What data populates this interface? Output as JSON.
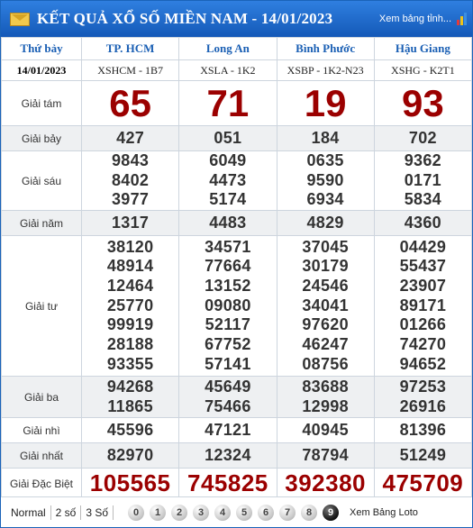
{
  "header": {
    "title": "KẾT QUẢ XỔ SỐ MIỀN NAM - 14/01/2023",
    "view_link": "Xem bảng tỉnh...",
    "bar_colors": [
      "#e23b3b",
      "#f0c419",
      "#3b8ee2"
    ]
  },
  "table": {
    "day": "Thứ bảy",
    "date": "14/01/2023",
    "provinces": [
      "TP. HCM",
      "Long An",
      "Bình Phước",
      "Hậu Giang"
    ],
    "codes": [
      "XSHCM - 1B7",
      "XSLA - 1K2",
      "XSBP - 1K2-N23",
      "XSHG - K2T1"
    ],
    "prizes": [
      {
        "label": "Giải tám",
        "results": [
          [
            "65"
          ],
          [
            "71"
          ],
          [
            "19"
          ],
          [
            "93"
          ]
        ]
      },
      {
        "label": "Giải bảy",
        "results": [
          [
            "427"
          ],
          [
            "051"
          ],
          [
            "184"
          ],
          [
            "702"
          ]
        ]
      },
      {
        "label": "Giải sáu",
        "results": [
          [
            "9843",
            "8402",
            "3977"
          ],
          [
            "6049",
            "4473",
            "5174"
          ],
          [
            "0635",
            "9590",
            "6934"
          ],
          [
            "9362",
            "0171",
            "5834"
          ]
        ]
      },
      {
        "label": "Giải năm",
        "results": [
          [
            "1317"
          ],
          [
            "4483"
          ],
          [
            "4829"
          ],
          [
            "4360"
          ]
        ]
      },
      {
        "label": "Giải tư",
        "results": [
          [
            "38120",
            "48914",
            "12464",
            "25770",
            "99919",
            "28188",
            "93355"
          ],
          [
            "34571",
            "77664",
            "13152",
            "09080",
            "52117",
            "67752",
            "57141"
          ],
          [
            "37045",
            "30179",
            "24546",
            "34041",
            "97620",
            "46247",
            "08756"
          ],
          [
            "04429",
            "55437",
            "23907",
            "89171",
            "01266",
            "74270",
            "94652"
          ]
        ]
      },
      {
        "label": "Giải ba",
        "results": [
          [
            "94268",
            "11865"
          ],
          [
            "45649",
            "75466"
          ],
          [
            "83688",
            "12998"
          ],
          [
            "97253",
            "26916"
          ]
        ]
      },
      {
        "label": "Giải nhì",
        "results": [
          [
            "45596"
          ],
          [
            "47121"
          ],
          [
            "40945"
          ],
          [
            "81396"
          ]
        ]
      },
      {
        "label": "Giải nhất",
        "results": [
          [
            "82970"
          ],
          [
            "12324"
          ],
          [
            "78794"
          ],
          [
            "51249"
          ]
        ]
      },
      {
        "label": "Giải Đặc Biệt",
        "results": [
          [
            "105565"
          ],
          [
            "745825"
          ],
          [
            "392380"
          ],
          [
            "475709"
          ]
        ]
      }
    ]
  },
  "footer": {
    "modes": [
      "Normal",
      "2 số",
      "3 Số"
    ],
    "digits": [
      "0",
      "1",
      "2",
      "3",
      "4",
      "5",
      "6",
      "7",
      "8",
      "9"
    ],
    "loto_link": "Xem Bảng Loto"
  }
}
